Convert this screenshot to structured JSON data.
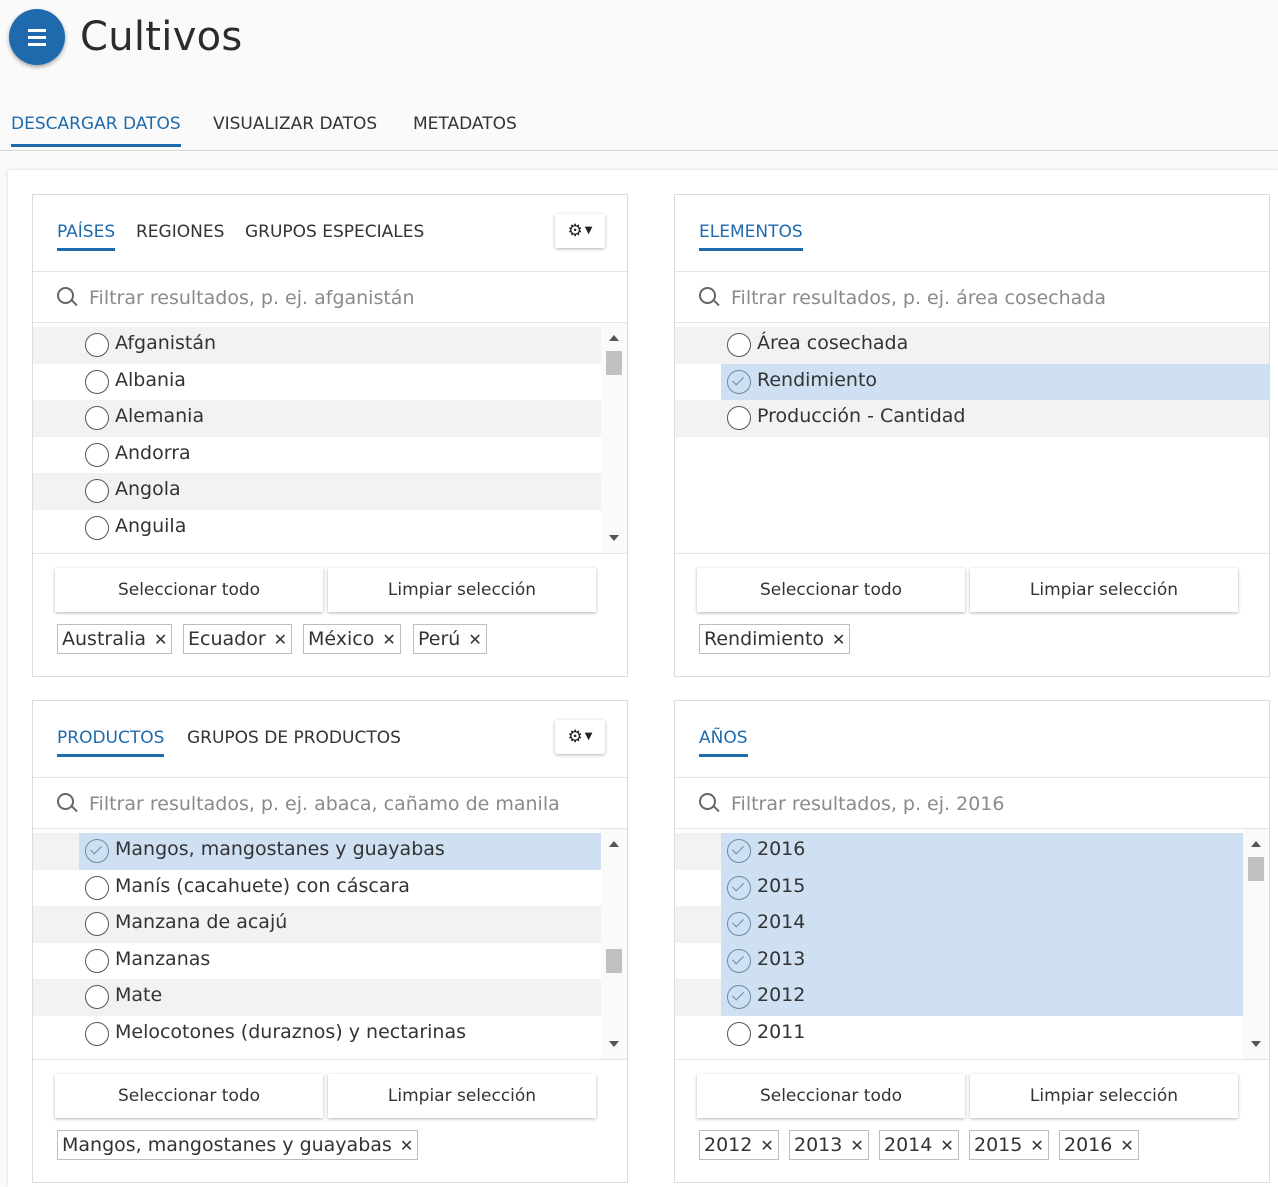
{
  "header": {
    "title": "Cultivos",
    "menu_icon": "hamburger-icon"
  },
  "main_tabs": [
    {
      "label": "DESCARGAR DATOS",
      "active": true
    },
    {
      "label": "VISUALIZAR DATOS",
      "active": false
    },
    {
      "label": "METADATOS",
      "active": false
    }
  ],
  "accent_color": "#1f6aad",
  "selection_color": "#cfe0f3",
  "panels": {
    "countries": {
      "tabs": [
        "PAÍSES",
        "REGIONES",
        "GRUPOS ESPECIALES"
      ],
      "search_placeholder": "Filtrar resultados, p. ej. afganistán",
      "items": [
        {
          "label": "Afganistán",
          "checked": false
        },
        {
          "label": "Albania",
          "checked": false
        },
        {
          "label": "Alemania",
          "checked": false
        },
        {
          "label": "Andorra",
          "checked": false
        },
        {
          "label": "Angola",
          "checked": false
        },
        {
          "label": "Anguila",
          "checked": false
        }
      ],
      "select_all": "Seleccionar todo",
      "clear": "Limpiar selección",
      "tags": [
        "Australia",
        "Ecuador",
        "México",
        "Perú"
      ]
    },
    "elements": {
      "tabs": [
        "ELEMENTOS"
      ],
      "search_placeholder": "Filtrar resultados, p. ej. área cosechada",
      "items": [
        {
          "label": "Área cosechada",
          "checked": false
        },
        {
          "label": "Rendimiento",
          "checked": true
        },
        {
          "label": "Producción - Cantidad",
          "checked": false
        }
      ],
      "select_all": "Seleccionar todo",
      "clear": "Limpiar selección",
      "tags": [
        "Rendimiento"
      ]
    },
    "products": {
      "tabs": [
        "PRODUCTOS",
        "GRUPOS DE PRODUCTOS"
      ],
      "search_placeholder": "Filtrar resultados, p. ej. abaca, cañamo de manila",
      "items": [
        {
          "label": "Mangos, mangostanes y guayabas",
          "checked": true
        },
        {
          "label": "Manís (cacahuete) con cáscara",
          "checked": false
        },
        {
          "label": "Manzana de acajú",
          "checked": false
        },
        {
          "label": "Manzanas",
          "checked": false
        },
        {
          "label": "Mate",
          "checked": false
        },
        {
          "label": "Melocotones (duraznos) y nectarinas",
          "checked": false
        }
      ],
      "select_all": "Seleccionar todo",
      "clear": "Limpiar selección",
      "tags": [
        "Mangos, mangostanes y guayabas"
      ]
    },
    "years": {
      "tabs": [
        "AÑOS"
      ],
      "search_placeholder": "Filtrar resultados, p. ej. 2016",
      "items": [
        {
          "label": "2016",
          "checked": true
        },
        {
          "label": "2015",
          "checked": true
        },
        {
          "label": "2014",
          "checked": true
        },
        {
          "label": "2013",
          "checked": true
        },
        {
          "label": "2012",
          "checked": true
        },
        {
          "label": "2011",
          "checked": false
        }
      ],
      "select_all": "Seleccionar todo",
      "clear": "Limpiar selección",
      "tags": [
        "2012",
        "2013",
        "2014",
        "2015",
        "2016"
      ]
    }
  },
  "gear_icon": "gear-icon"
}
